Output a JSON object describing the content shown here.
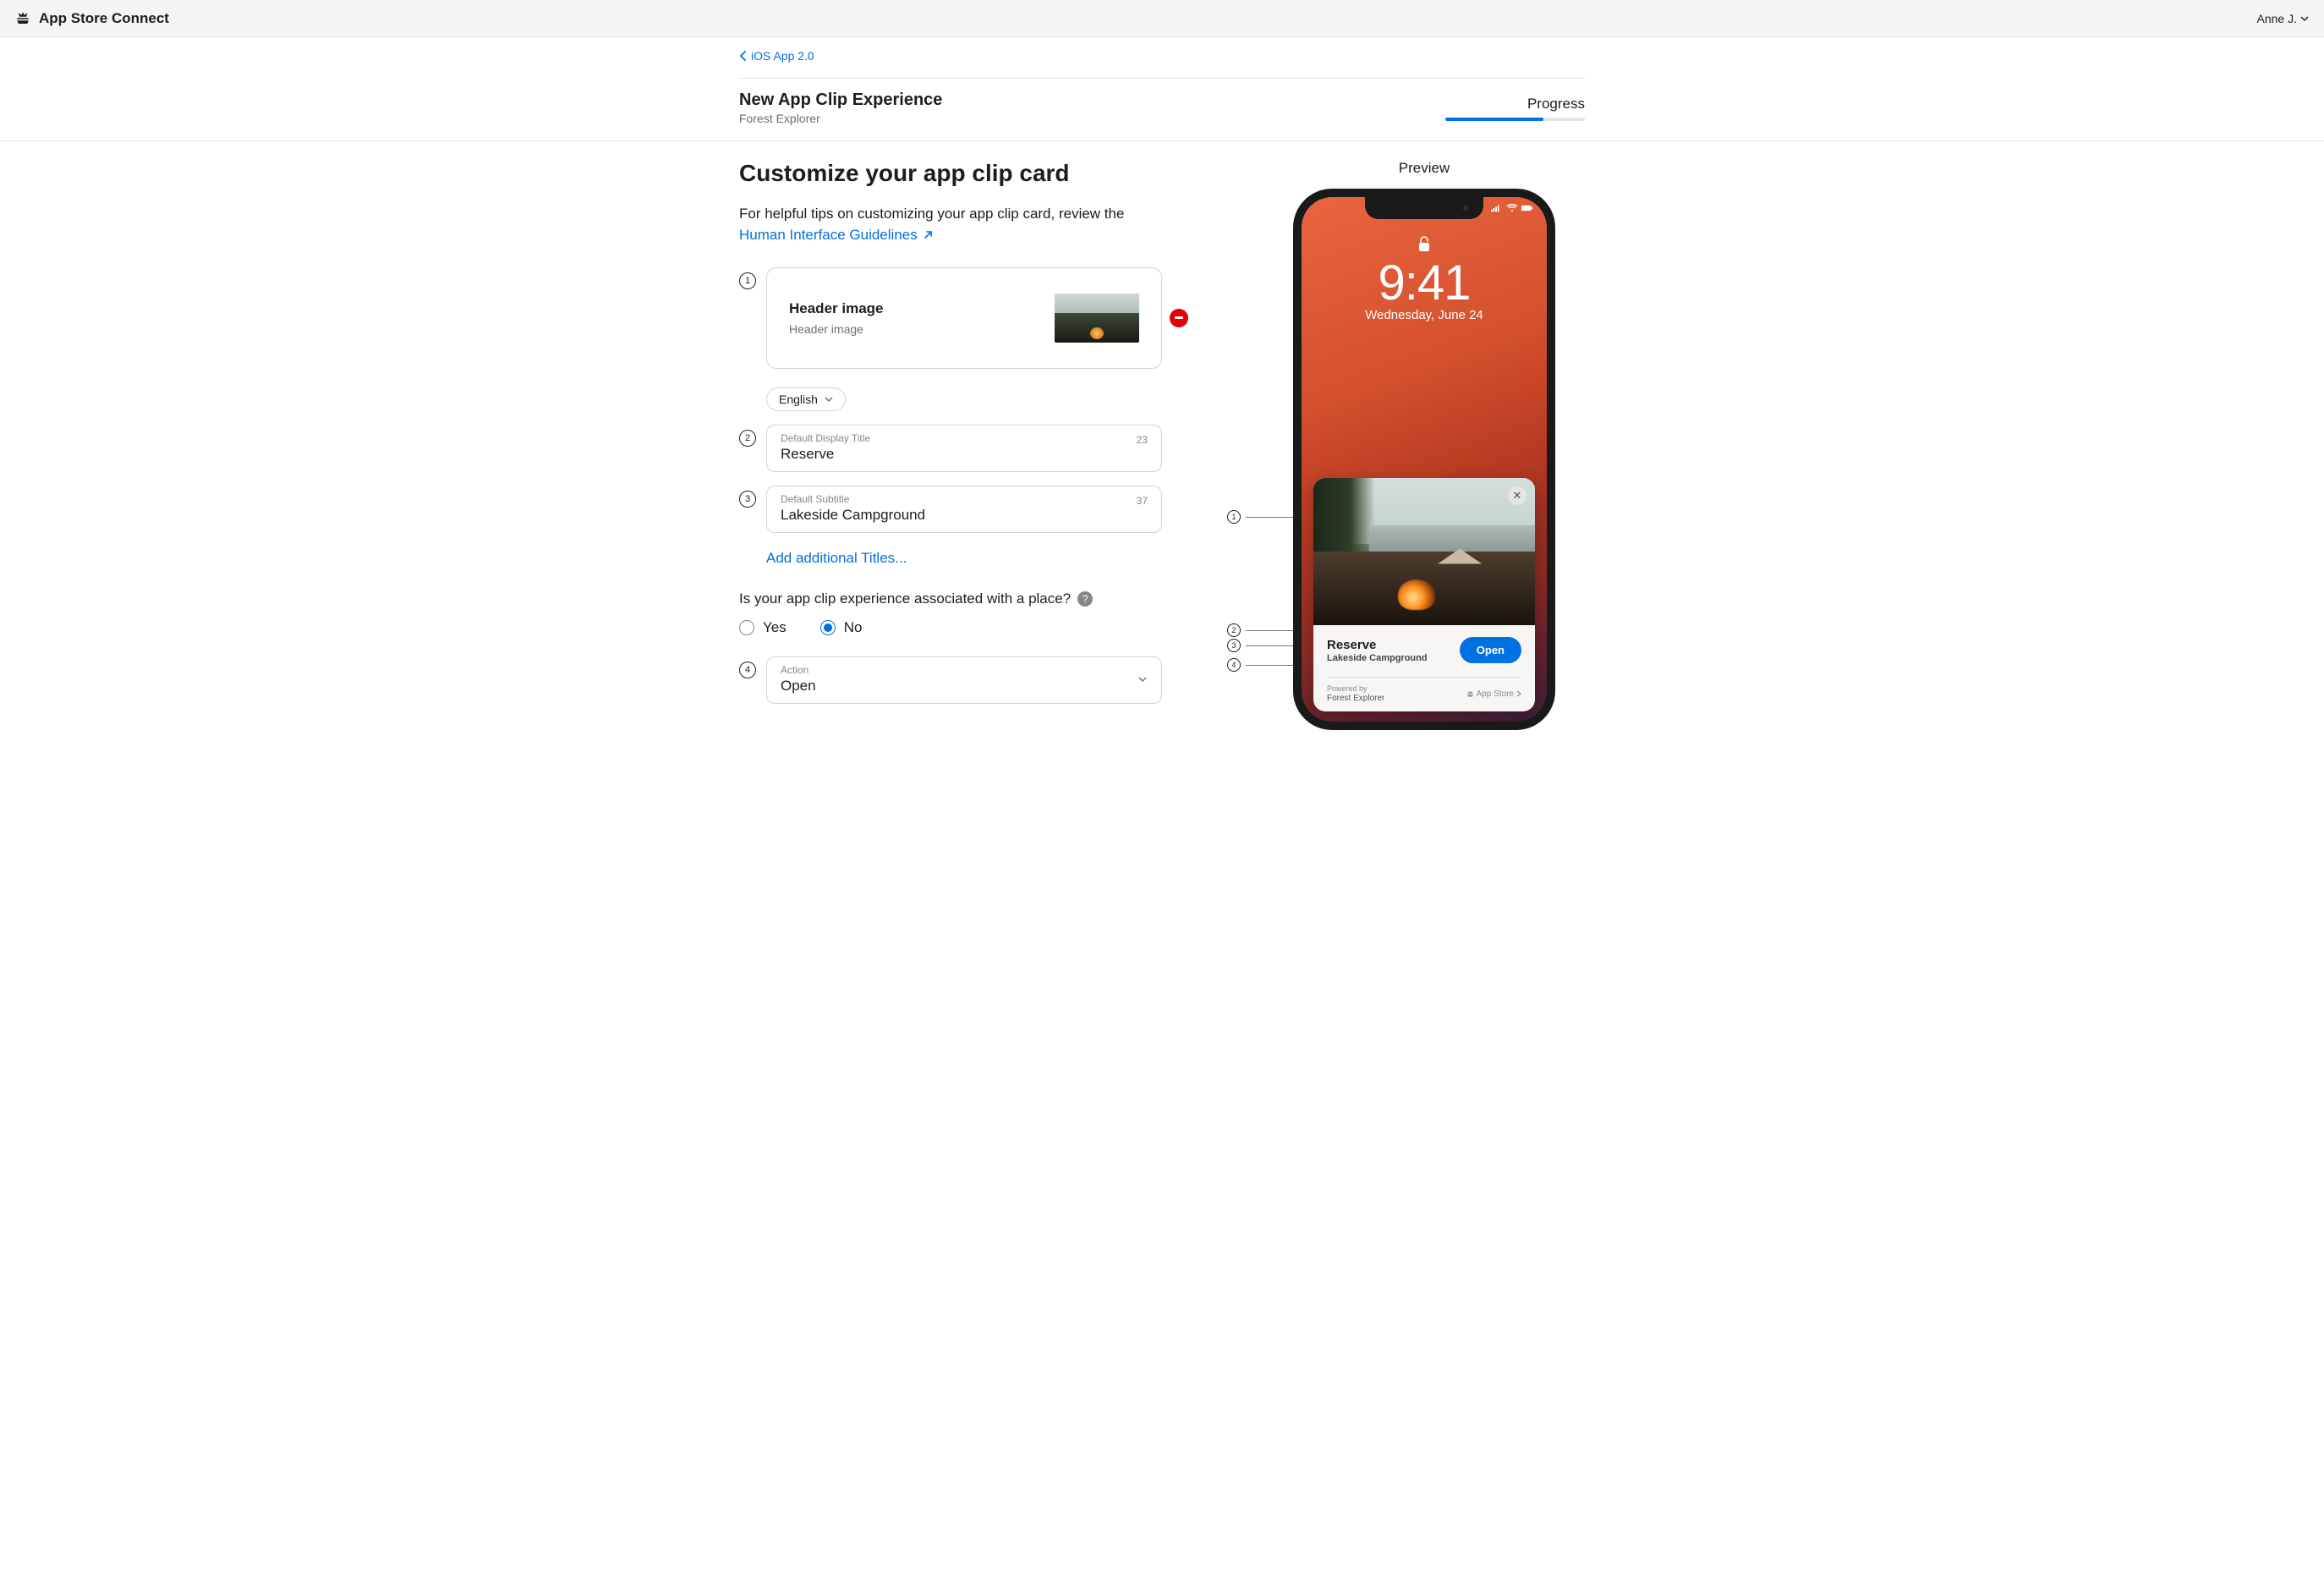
{
  "topbar": {
    "app_name": "App Store Connect",
    "user_name": "Anne J."
  },
  "subheader": {
    "back_label": "iOS App 2.0",
    "title": "New App Clip Experience",
    "subtitle": "Forest Explorer",
    "progress_label": "Progress",
    "progress_percent": 70
  },
  "section": {
    "title": "Customize your app clip card",
    "intro_prefix": "For helpful tips on customizing your app clip card, review the",
    "hig_link": "Human Interface Guidelines"
  },
  "steps": {
    "s1": "1",
    "s2": "2",
    "s3": "3",
    "s4": "4"
  },
  "header_image": {
    "title": "Header image",
    "subtitle": "Header image"
  },
  "language": {
    "selected": "English"
  },
  "title_field": {
    "label": "Default Display Title",
    "value": "Reserve",
    "remaining": "23"
  },
  "subtitle_field": {
    "label": "Default Subtitle",
    "value": "Lakeside Campground",
    "remaining": "37"
  },
  "add_titles": "Add additional Titles...",
  "place_question": "Is your app clip experience associated with a place?",
  "radio": {
    "yes": "Yes",
    "no": "No",
    "selected": "no"
  },
  "action_field": {
    "label": "Action",
    "value": "Open"
  },
  "preview": {
    "label": "Preview",
    "time": "9:41",
    "date": "Wednesday, June 24",
    "clip_title": "Reserve",
    "clip_subtitle": "Lakeside Campground",
    "clip_action": "Open",
    "powered_by": "Powered by",
    "app_name": "Forest Explorer",
    "app_store": "App Store"
  },
  "annotations": {
    "a1": "1",
    "a2": "2",
    "a3": "3",
    "a4": "4"
  }
}
